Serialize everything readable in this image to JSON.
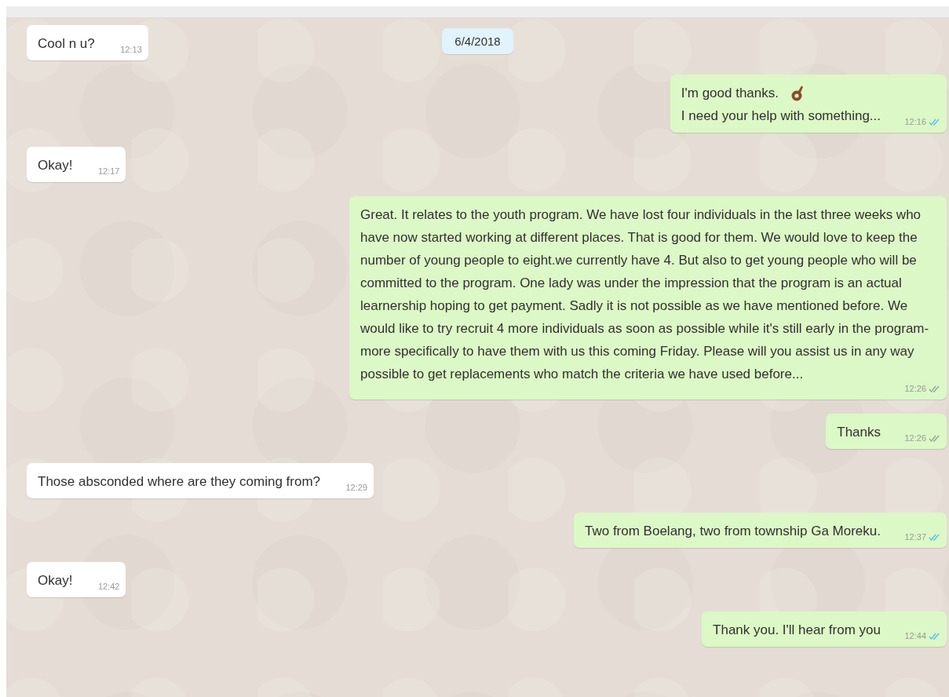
{
  "date_chip": "6/4/2018",
  "messages": [
    {
      "kind": "incoming",
      "lines": [
        "Cool n u?"
      ],
      "time": "12:13"
    },
    {
      "kind": "outgoing",
      "lines": [
        "I'm good thanks.",
        "I need your help with something..."
      ],
      "time": "12:16",
      "read": true
    },
    {
      "kind": "incoming",
      "lines": [
        "Okay!"
      ],
      "time": "12:17"
    },
    {
      "kind": "outgoing",
      "lines": [
        "Great. It relates to the youth program. We have lost four individuals in the last three weeks who have now started working at different places. That is good for them. We would love to keep the number of young people to eight.we currently have 4.  But also to get young people who will be committed to the program. One lady was under the impression that the program is an actual learnership hoping to get payment. Sadly it is not possible as we have mentioned before. We would like to try recruit 4 more individuals as soon as possible while it's still early in the program- more specifically to have them with us this coming Friday. Please will you assist us in any way possible to get replacements who match the criteria we have used before..."
      ],
      "time": "12:26",
      "read": false
    },
    {
      "kind": "outgoing",
      "lines": [
        "Thanks"
      ],
      "time": "12:26",
      "read": false
    },
    {
      "kind": "incoming",
      "lines": [
        "Those absconded where are they coming from?"
      ],
      "time": "12:29"
    },
    {
      "kind": "outgoing",
      "lines": [
        "Two from Boelang, two from township Ga Moreku."
      ],
      "time": "12:37",
      "read": true
    },
    {
      "kind": "incoming",
      "lines": [
        "Okay!"
      ],
      "time": "12:42"
    },
    {
      "kind": "outgoing",
      "lines": [
        "Thank you. I'll hear from you"
      ],
      "time": "12:44",
      "read": true
    }
  ]
}
